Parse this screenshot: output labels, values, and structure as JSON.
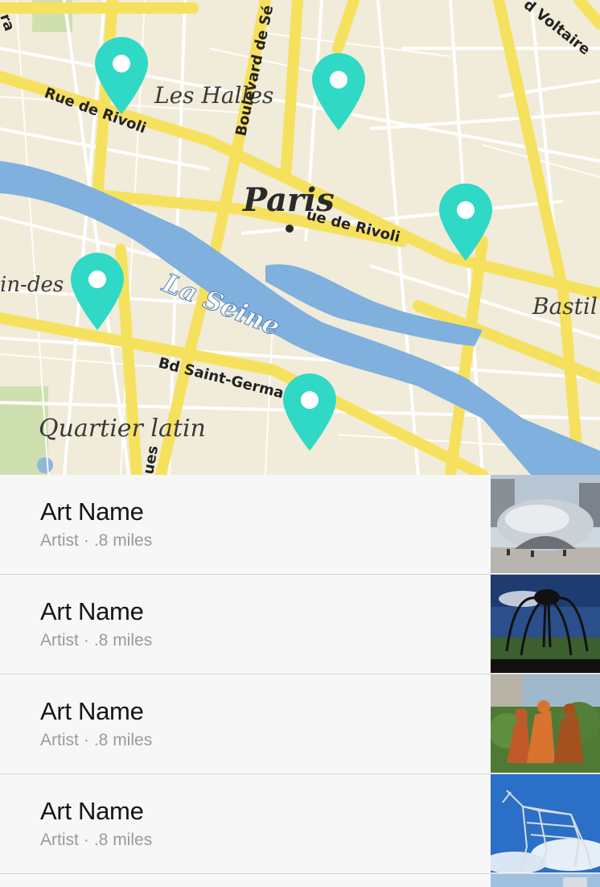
{
  "map": {
    "labels": {
      "les_halles": "Les Halles",
      "paris": "Paris",
      "la_seine": "La Seine",
      "quartier_latin": "Quartier latin",
      "bastille": "Bastil",
      "saint_germain_des_pres": "in-des",
      "rue_de_rivoli_west": "Rue de Rivoli",
      "rue_de_rivoli_east": "ue de Rivoli",
      "boulevard_sebastopol": "Boulevard de Sé",
      "boulevard_voltaire": "d Voltaire",
      "bd_saint_germain": "Bd Saint-Germain",
      "rue_left_top": "ra",
      "rue_bottom": "ues"
    },
    "pin_color": "#2fd9c6",
    "pin_count": 5
  },
  "list": {
    "items": [
      {
        "title": "Art Name",
        "artist": "Artist",
        "separator": "·",
        "distance": ".8 miles",
        "thumb_icon": "cloud-gate-thumbnail"
      },
      {
        "title": "Art Name",
        "artist": "Artist",
        "separator": "·",
        "distance": ".8 miles",
        "thumb_icon": "spider-sculpture-thumbnail"
      },
      {
        "title": "Art Name",
        "artist": "Artist",
        "separator": "·",
        "distance": ".8 miles",
        "thumb_icon": "figures-sculpture-thumbnail"
      },
      {
        "title": "Art Name",
        "artist": "Artist",
        "separator": "·",
        "distance": ".8 miles",
        "thumb_icon": "horse-sculpture-thumbnail"
      }
    ]
  }
}
